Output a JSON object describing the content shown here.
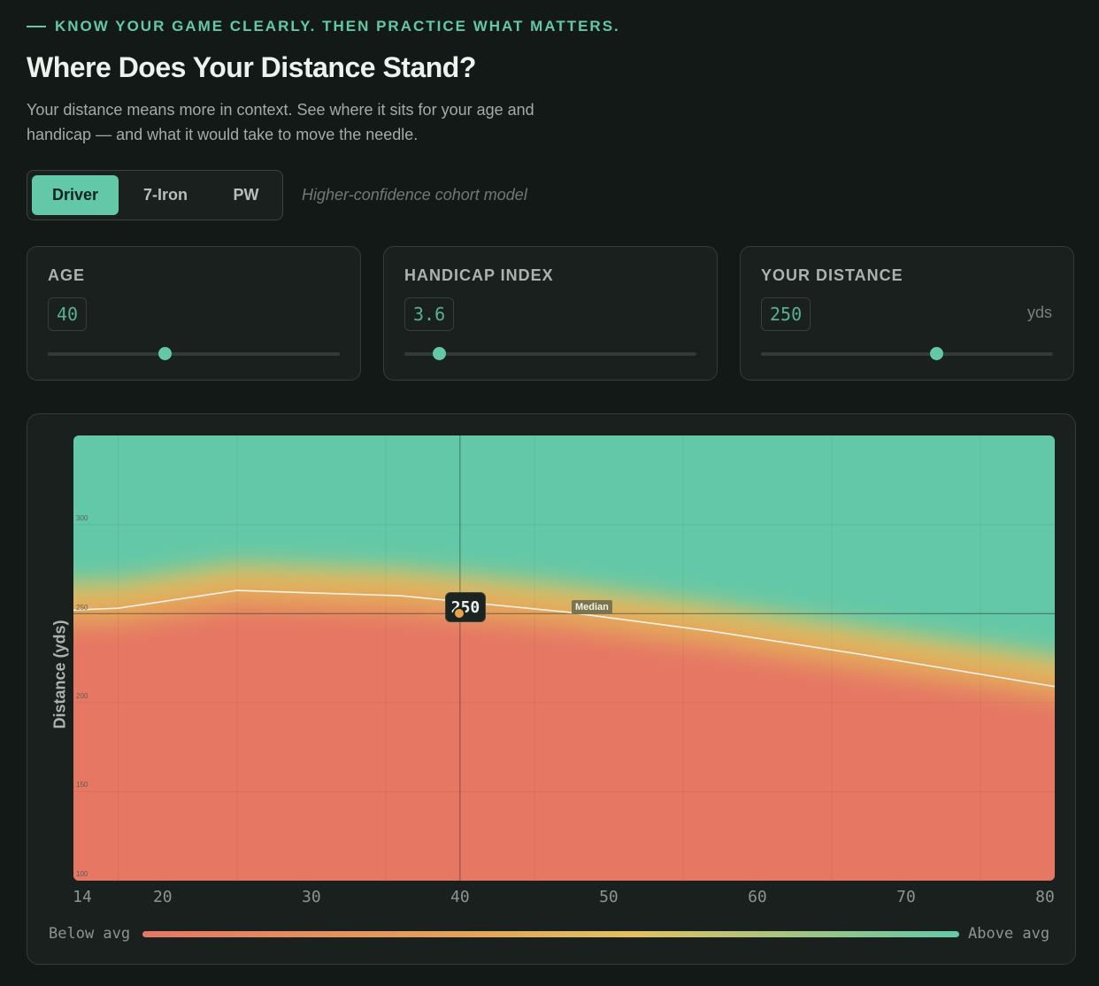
{
  "header": {
    "eyebrow": "KNOW YOUR GAME CLEARLY. THEN PRACTICE WHAT MATTERS.",
    "title": "Where Does Your Distance Stand?",
    "subtitle": "Your distance means more in context. See where it sits for your age and handicap — and what it would take to move the needle."
  },
  "club_tabs": [
    {
      "label": "Driver",
      "active": true
    },
    {
      "label": "7-Iron",
      "active": false
    },
    {
      "label": "PW",
      "active": false
    }
  ],
  "model_note": "Higher-confidence cohort model",
  "controls": {
    "age": {
      "label": "AGE",
      "value": "40",
      "slider_fraction": 0.4
    },
    "handicap": {
      "label": "HANDICAP INDEX",
      "value": "3.6",
      "slider_fraction": 0.12
    },
    "distance": {
      "label": "YOUR DISTANCE",
      "value": "250",
      "unit": "yds",
      "slider_fraction": 0.6
    }
  },
  "colors": {
    "accent": "#63c8a7",
    "below": "#e57764",
    "mid": "#e2c061",
    "above": "#63c8a7",
    "marker": "#e8a34a"
  },
  "chart_data": {
    "type": "heatmap",
    "ylabel": "Distance (yds)",
    "xlabel": "",
    "x_ticks": [
      "14",
      "20",
      "30",
      "40",
      "50",
      "60",
      "70",
      "80"
    ],
    "y_ticks": [
      "300",
      "250",
      "200",
      "150",
      "100"
    ],
    "xlim": [
      14,
      80
    ],
    "ylim": [
      100,
      350
    ],
    "median_label": "Median",
    "median_curve": {
      "x": [
        14,
        17,
        25,
        36,
        47,
        57,
        67,
        80
      ],
      "y": [
        252,
        253,
        263,
        260,
        251,
        240,
        227,
        209
      ]
    },
    "you": {
      "age": 40,
      "distance": 250,
      "label": "250"
    },
    "legend": {
      "low": "Below avg",
      "high": "Above avg"
    }
  }
}
